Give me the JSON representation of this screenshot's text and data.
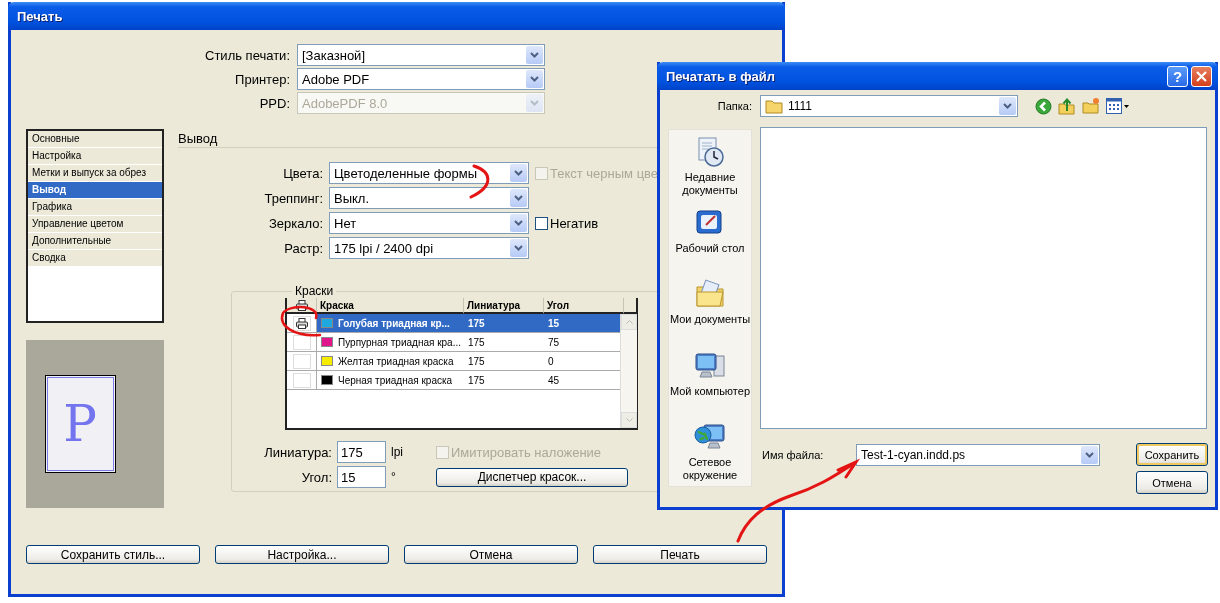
{
  "print_dialog": {
    "title": "Печать",
    "top_fields": [
      {
        "label": "Стиль печати:",
        "value": "[Заказной]",
        "disabled": false
      },
      {
        "label": "Принтер:",
        "value": "Adobe PDF",
        "disabled": false
      },
      {
        "label": "PPD:",
        "value": "AdobePDF 8.0",
        "disabled": true
      }
    ],
    "sidebar": {
      "items": [
        {
          "label": "Основные",
          "selected": false
        },
        {
          "label": "Настройка",
          "selected": false
        },
        {
          "label": "Метки и выпуск за обрез",
          "selected": false
        },
        {
          "label": "Вывод",
          "selected": true
        },
        {
          "label": "Графика",
          "selected": false
        },
        {
          "label": "Управление цветом",
          "selected": false
        },
        {
          "label": "Дополнительные",
          "selected": false
        },
        {
          "label": "Сводка",
          "selected": false
        }
      ]
    },
    "preview_text": "P",
    "section_title": "Вывод",
    "output_fields": [
      {
        "label": "Цвета:",
        "value": "Цветоделенные формы",
        "checkbox": {
          "label": "Текст черным цве",
          "checked": false,
          "disabled": true
        }
      },
      {
        "label": "Треппинг:",
        "value": "Выкл."
      },
      {
        "label": "Зеркало:",
        "value": "Нет",
        "checkbox": {
          "label": "Негатив",
          "checked": false,
          "disabled": false
        }
      },
      {
        "label": "Растр:",
        "value": "175 lpi / 2400 dpi"
      }
    ],
    "inks": {
      "title": "Краски",
      "columns": [
        "Краска",
        "Линиатура",
        "Угол"
      ],
      "rows": [
        {
          "print": true,
          "selected": true,
          "color": "#1ea8e0",
          "name": "Голубая триадная кр...",
          "frequency": "175",
          "angle": "15"
        },
        {
          "print": false,
          "selected": false,
          "color": "#e0158c",
          "name": "Пурпурная триадная кра...",
          "frequency": "175",
          "angle": "75"
        },
        {
          "print": false,
          "selected": false,
          "color": "#f5ec00",
          "name": "Желтая триадная краска",
          "frequency": "175",
          "angle": "0"
        },
        {
          "print": false,
          "selected": false,
          "color": "#000000",
          "name": "Черная триадная краска",
          "frequency": "175",
          "angle": "45"
        }
      ],
      "frequency": {
        "label": "Линиатура:",
        "value": "175",
        "unit": "lpi"
      },
      "angle": {
        "label": "Угол:",
        "value": "15",
        "unit": "°"
      },
      "simulate": {
        "label": "Имитировать наложение",
        "checked": false,
        "disabled": true
      },
      "ink_manager_button": "Диспетчер красок..."
    },
    "buttons": [
      "Сохранить стиль...",
      "Настройка...",
      "Отмена",
      "Печать"
    ]
  },
  "file_dialog": {
    "title": "Печатать в файл",
    "help_button": "?",
    "folder_label": "Папка:",
    "folder": "1111",
    "places": [
      {
        "kind": "recent",
        "label": "Недавние документы"
      },
      {
        "kind": "desktop",
        "label": "Рабочий стол"
      },
      {
        "kind": "documents",
        "label": "Мои документы"
      },
      {
        "kind": "computer",
        "label": "Мой компьютер"
      },
      {
        "kind": "network",
        "label": "Сетевое окружение"
      }
    ],
    "filename_label": "Имя файла:",
    "filename": "Test-1-cyan.indd.ps",
    "buttons": [
      {
        "label": "Сохранить",
        "default": true
      },
      {
        "label": "Отмена",
        "default": false
      }
    ]
  }
}
